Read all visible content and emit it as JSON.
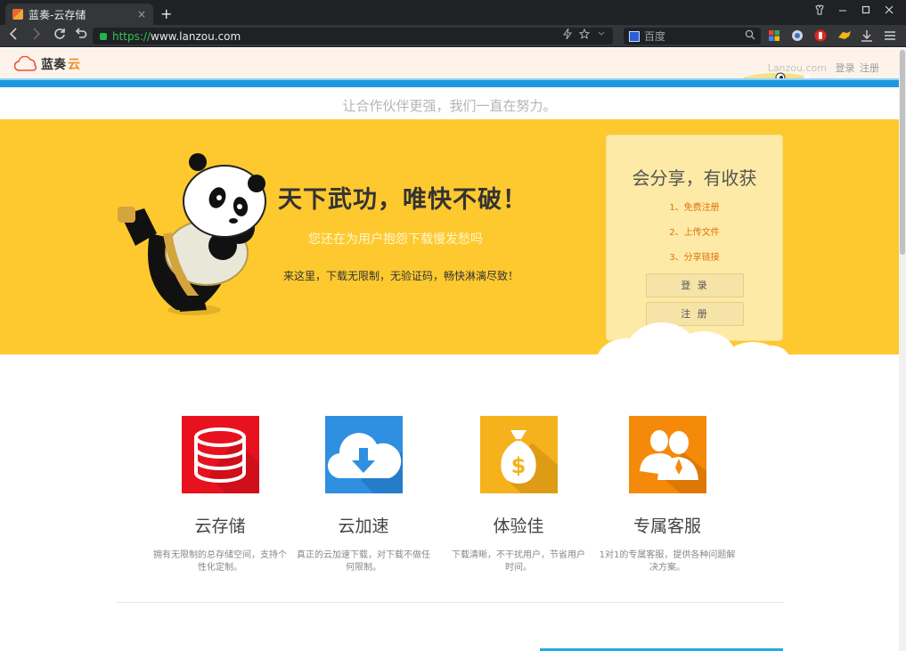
{
  "browser": {
    "tab_title": "蓝奏-云存储",
    "tab_close": "×",
    "new_tab": "+",
    "url_scheme": "https://",
    "url_host": "www.lanzou.com",
    "search_placeholder": "百度"
  },
  "header": {
    "logo_part1": "蓝奏",
    "logo_part2": "云",
    "domain_text": "Lanzou.com",
    "login_link": "登录",
    "register_link": "注册"
  },
  "slogan": "让合作伙伴更强，我们一直在努力。",
  "hero": {
    "headline": "天下武功，唯快不破！",
    "subline": "您还在为用户抱怨下载慢发愁吗",
    "description": "来这里，下载无限制，无验证码，畅快淋漓尽致！"
  },
  "panel": {
    "title": "会分享，有收获",
    "steps": [
      "1、免费注册",
      "2、上传文件",
      "3、分享链接"
    ],
    "login_button": "登 录",
    "register_button": "注 册"
  },
  "features": [
    {
      "title": "云存储",
      "description": "拥有无限制的总存储空间，支持个性化定制。",
      "icon": "database-icon",
      "color": "#e8121e"
    },
    {
      "title": "云加速",
      "description": "真正的云加速下载，对下载不做任何限制。",
      "icon": "cloud-download-icon",
      "color": "#2f8fe0"
    },
    {
      "title": "体验佳",
      "description": "下载清晰，不干扰用户，节省用户时间。",
      "icon": "money-bag-icon",
      "color": "#f5b21c"
    },
    {
      "title": "专属客服",
      "description": "1对1的专属客服，提供各种问题解决方案。",
      "icon": "support-users-icon",
      "color": "#f58a0a"
    }
  ],
  "colors": {
    "hero_bg": "#fdc92f",
    "header_bg": "#fdf3ea",
    "accent_blue": "#1d98de",
    "step_orange": "#e2700e"
  }
}
